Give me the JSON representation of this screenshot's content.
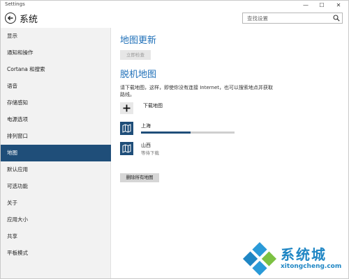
{
  "window": {
    "title": "Settings",
    "min_glyph": "—",
    "max_glyph": "☐",
    "close_glyph": "✕"
  },
  "header": {
    "title": "系统",
    "search_placeholder": "查找设置"
  },
  "sidebar": {
    "active_index": 7,
    "items": [
      {
        "label": "显示"
      },
      {
        "label": "通知和操作"
      },
      {
        "label": "Cortana 和搜索"
      },
      {
        "label": "语音"
      },
      {
        "label": "存储感知"
      },
      {
        "label": "电源选项"
      },
      {
        "label": "排列窗口"
      },
      {
        "label": "地图"
      },
      {
        "label": "默认应用"
      },
      {
        "label": "可选功能"
      },
      {
        "label": "关于"
      },
      {
        "label": "应用大小"
      },
      {
        "label": "共享"
      },
      {
        "label": "平板模式"
      }
    ]
  },
  "main": {
    "map_update_title": "地图更新",
    "check_now_label": "立即检查",
    "offline_title": "脱机地图",
    "description": "请下载地图，这样，即使你没有连接 Internet，也可以搜索地点并获取路线。",
    "download_label": "下载地图",
    "maps": [
      {
        "name": "上海",
        "status": "",
        "progress": 0.53
      },
      {
        "name": "山西",
        "status": "等待下载"
      }
    ],
    "delete_all_label": "删除所有地图"
  },
  "watermark": {
    "text": "系统城",
    "url": "xitongcheng.com"
  },
  "colors": {
    "accent": "#1f4e79",
    "heading": "#1e6fb8",
    "sidebar_bg": "#f2f2f2"
  },
  "icons": {
    "back": "back-arrow-icon",
    "search": "search-icon",
    "add": "plus-icon",
    "map": "map-icon"
  }
}
